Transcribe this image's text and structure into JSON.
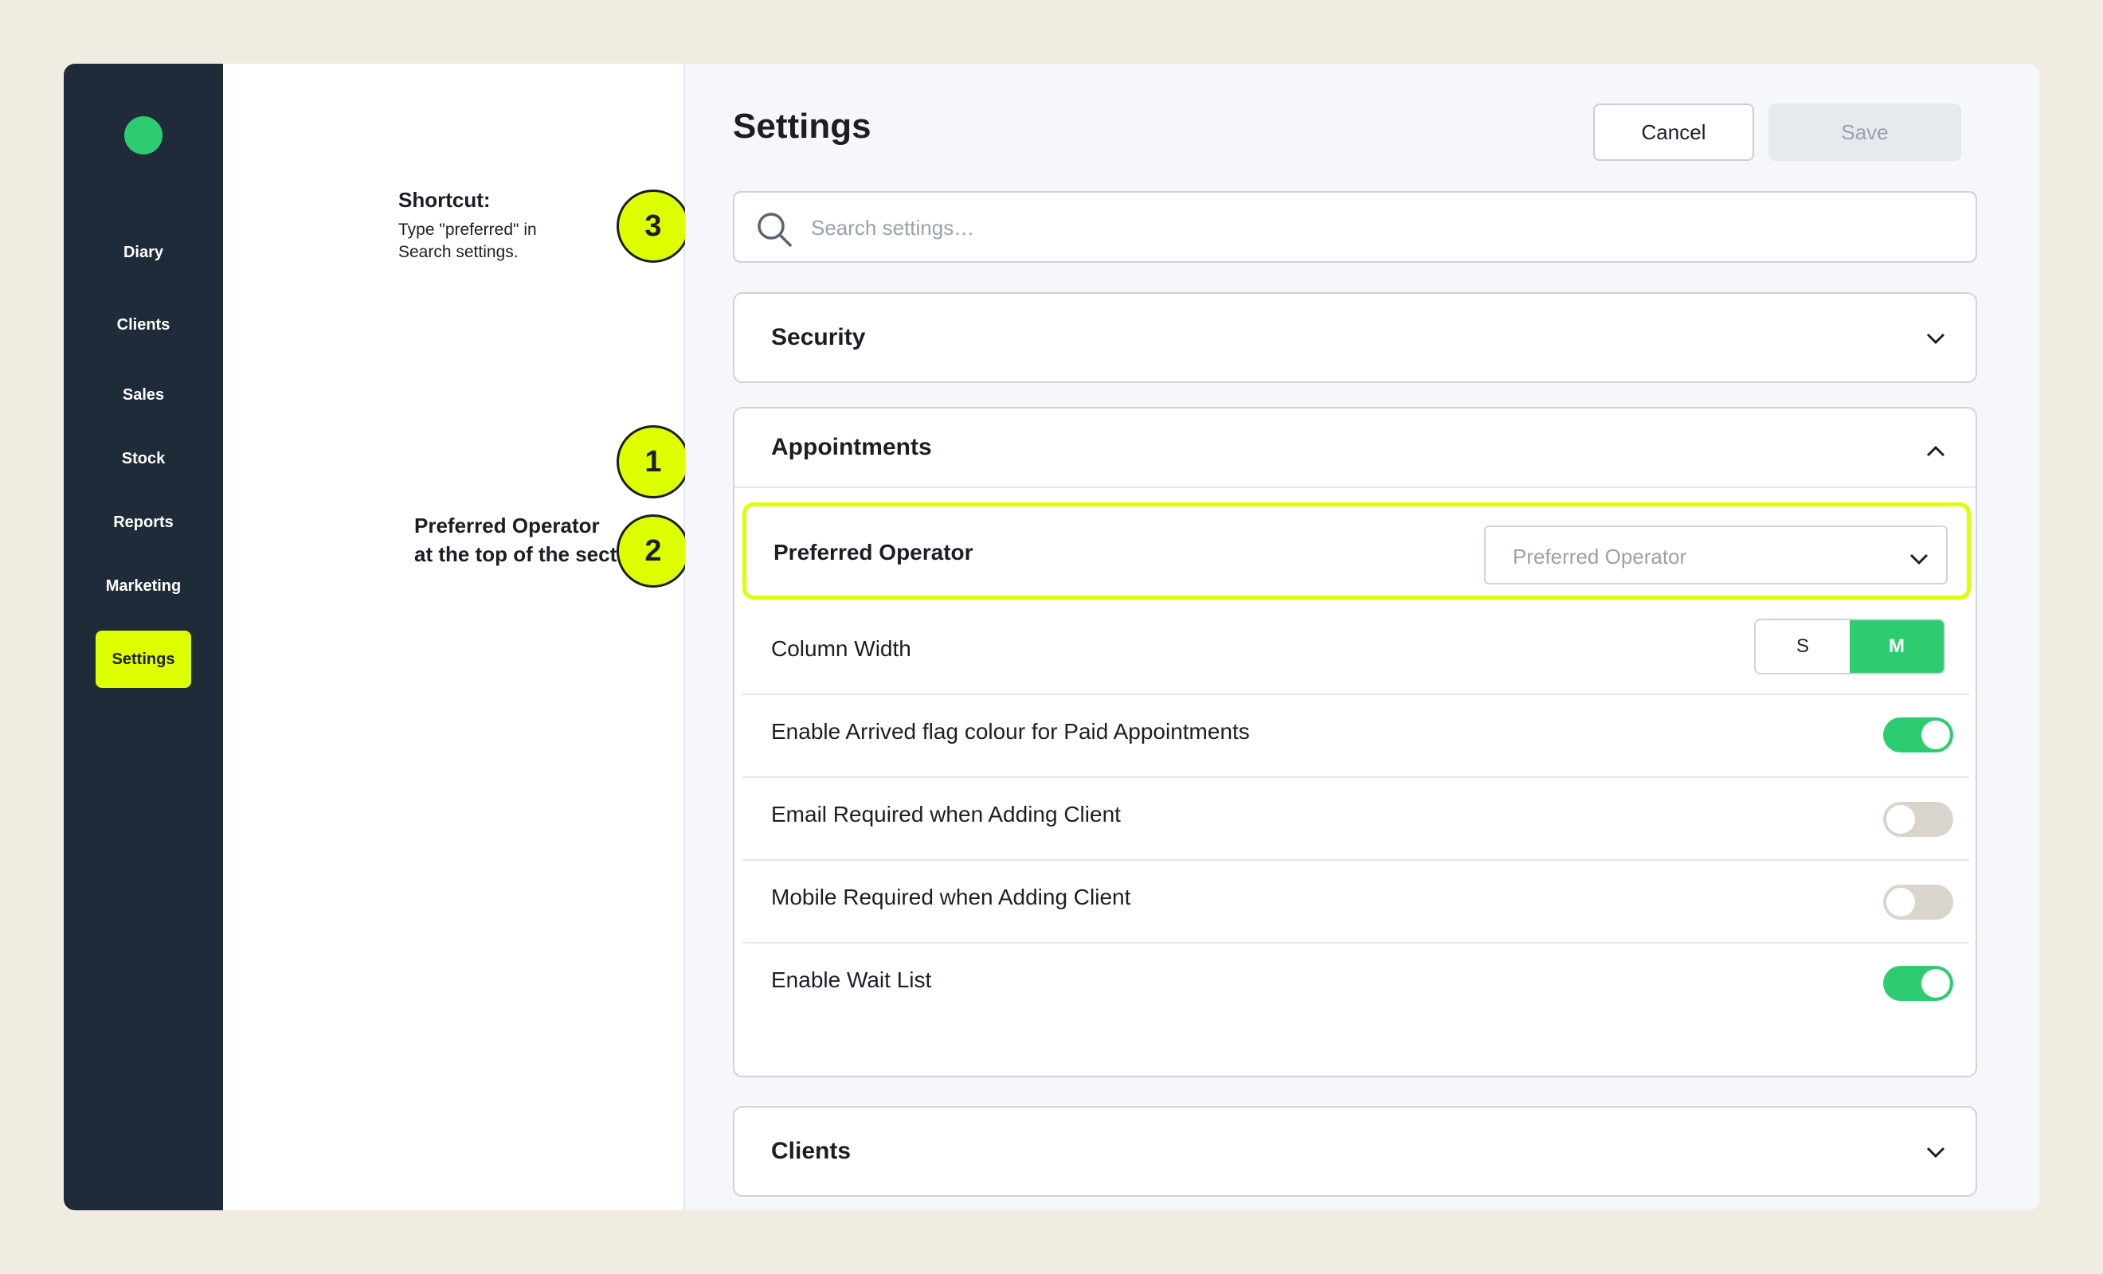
{
  "sidebar": {
    "logo": "logo-dot",
    "items": [
      {
        "label": "Diary",
        "active": false
      },
      {
        "label": "Clients",
        "active": false
      },
      {
        "label": "Sales",
        "active": false
      },
      {
        "label": "Stock",
        "active": false
      },
      {
        "label": "Reports",
        "active": false
      },
      {
        "label": "Marketing",
        "active": false
      },
      {
        "label": "Settings",
        "active": true
      }
    ]
  },
  "annotations": {
    "shortcut_title": "Shortcut:",
    "shortcut_line1": "Type \"preferred\" in",
    "shortcut_line2": "Search settings.",
    "preferred_line1": "Preferred Operator",
    "preferred_line2": "at the top of the section.",
    "markers": [
      "3",
      "1",
      "2"
    ]
  },
  "header": {
    "title": "Settings",
    "cancel_label": "Cancel",
    "save_label": "Save"
  },
  "search": {
    "placeholder": "Search settings…",
    "value": ""
  },
  "sections": {
    "security": {
      "title": "Security",
      "expanded": false
    },
    "appointments": {
      "title": "Appointments",
      "expanded": true,
      "preferred_operator": {
        "label": "Preferred Operator",
        "placeholder": "Preferred Operator"
      },
      "column_width": {
        "label": "Column Width",
        "options": [
          "S",
          "M"
        ],
        "selected": "M"
      },
      "toggles": [
        {
          "label": "Enable Arrived flag colour for Paid Appointments",
          "on": true
        },
        {
          "label": "Email Required when Adding Client",
          "on": false
        },
        {
          "label": "Mobile Required when Adding Client",
          "on": false
        },
        {
          "label": "Enable Wait List",
          "on": true
        }
      ]
    },
    "clients": {
      "title": "Clients",
      "expanded": false
    }
  },
  "colors": {
    "sidebar_bg": "#1f2b38",
    "accent_lime": "#ddff00",
    "accent_green": "#2ecc71",
    "toggle_off": "#d9d5cc"
  }
}
